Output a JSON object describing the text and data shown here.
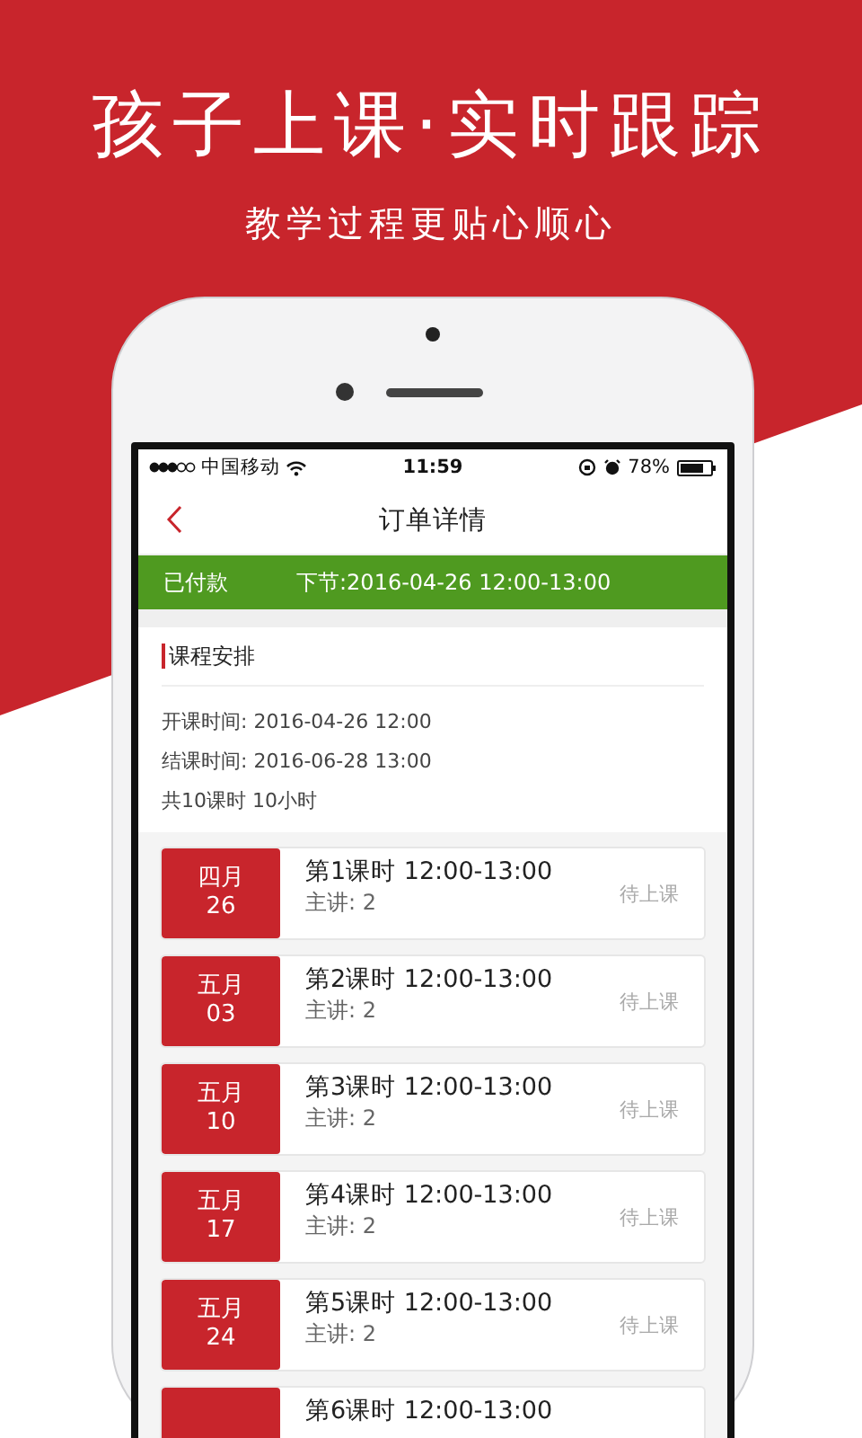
{
  "headline": "孩子上课·实时跟踪",
  "subtitle": "教学过程更贴心顺心",
  "status_bar": {
    "carrier": "中国移动",
    "time": "11:59",
    "battery": "78%"
  },
  "nav": {
    "title": "订单详情"
  },
  "order": {
    "status": "已付款",
    "next": "下节:2016-04-26 12:00-13:00"
  },
  "schedule": {
    "title": "课程安排",
    "lines": [
      "开课时间: 2016-04-26 12:00",
      "结课时间: 2016-06-28 13:00",
      "共10课时  10小时"
    ]
  },
  "lessons": [
    {
      "month": "四月",
      "day": "26",
      "title": "第1课时 12:00-13:00",
      "teacher": "主讲: 2",
      "status": "待上课"
    },
    {
      "month": "五月",
      "day": "03",
      "title": "第2课时 12:00-13:00",
      "teacher": "主讲: 2",
      "status": "待上课"
    },
    {
      "month": "五月",
      "day": "10",
      "title": "第3课时 12:00-13:00",
      "teacher": "主讲: 2",
      "status": "待上课"
    },
    {
      "month": "五月",
      "day": "17",
      "title": "第4课时 12:00-13:00",
      "teacher": "主讲: 2",
      "status": "待上课"
    },
    {
      "month": "五月",
      "day": "24",
      "title": "第5课时 12:00-13:00",
      "teacher": "主讲: 2",
      "status": "待上课"
    },
    {
      "title": "第6课时 12:00-13:00"
    }
  ]
}
